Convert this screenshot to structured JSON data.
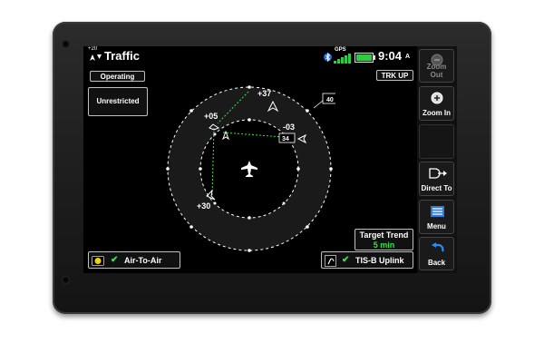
{
  "header": {
    "altitude_hint": "+20",
    "title": "Traffic",
    "gps_label": "GPS",
    "time": "9:04",
    "time_suffix": "A"
  },
  "left_controls": {
    "operating": "Operating",
    "unrestricted": "Unrestricted"
  },
  "orientation": "TRK UP",
  "traffic": [
    {
      "label": "+37"
    },
    {
      "label": "+05"
    },
    {
      "label": "-03"
    },
    {
      "label": "+30"
    }
  ],
  "callouts": {
    "track_a": "40",
    "track_b": "34"
  },
  "target_trend": {
    "title": "Target Trend",
    "value": "5 min"
  },
  "bottom": {
    "air_to_air": "Air-To-Air",
    "tis_b": "TIS-B Uplink"
  },
  "side_buttons": {
    "zoom_out": "Zoom Out",
    "zoom_in": "Zoom In",
    "direct_to": "Direct To",
    "menu": "Menu",
    "back": "Back"
  },
  "colors": {
    "accent_green": "#34e34a",
    "battery_green": "#2ecc40",
    "screen_bg": "#000000"
  }
}
